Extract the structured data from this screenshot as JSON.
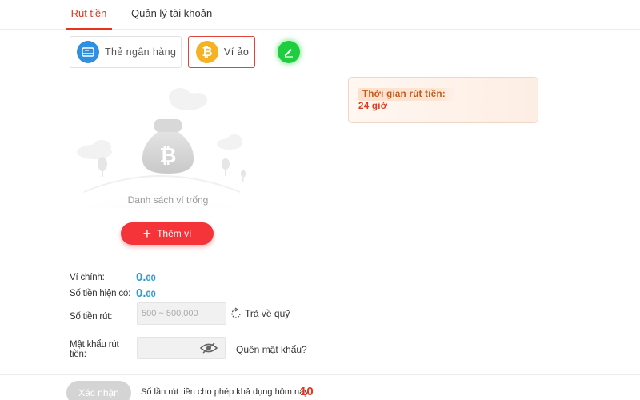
{
  "tabs": [
    {
      "label": "Rút tiền",
      "active": true
    },
    {
      "label": "Quản lý tài khoản",
      "active": false
    }
  ],
  "methods": {
    "bank": {
      "label": "Thẻ ngân hàng",
      "icon": "bank-card-icon"
    },
    "wallet": {
      "label": "Ví ảo",
      "icon": "bitcoin-icon",
      "selected": true
    }
  },
  "edit_icon": "pencil-icon",
  "empty_wallet": {
    "text": "Danh sách ví trống",
    "icon": "bitcoin-bag-icon"
  },
  "add_wallet": {
    "label": "Thêm ví"
  },
  "notice": {
    "label": "Thời gian rút tiền:",
    "value": "24 giờ"
  },
  "form": {
    "main_wallet": {
      "label": "Ví chính:",
      "integer": "0.",
      "decimal": "00"
    },
    "available": {
      "label": "Số tiền hiện có:",
      "integer": "0.",
      "decimal": "00"
    },
    "amount": {
      "label": "Số tiền rút:",
      "placeholder": "500 ~ 500,000"
    },
    "reset": {
      "label": "Trả về quỹ"
    },
    "password": {
      "label": "Mật khẩu rút tiền:",
      "value": ""
    },
    "forgot": {
      "label": "Quên mật khẩu?"
    }
  },
  "footer": {
    "confirm_label": "Xác nhận",
    "limit_text": "Số lần rút tiền cho phép khả dụng hôm nay:",
    "limit_count": "10"
  },
  "colors": {
    "accent": "#e8341d",
    "button": "#f5343a",
    "amount": "#2a9ad8",
    "edit": "#1fce3f"
  }
}
